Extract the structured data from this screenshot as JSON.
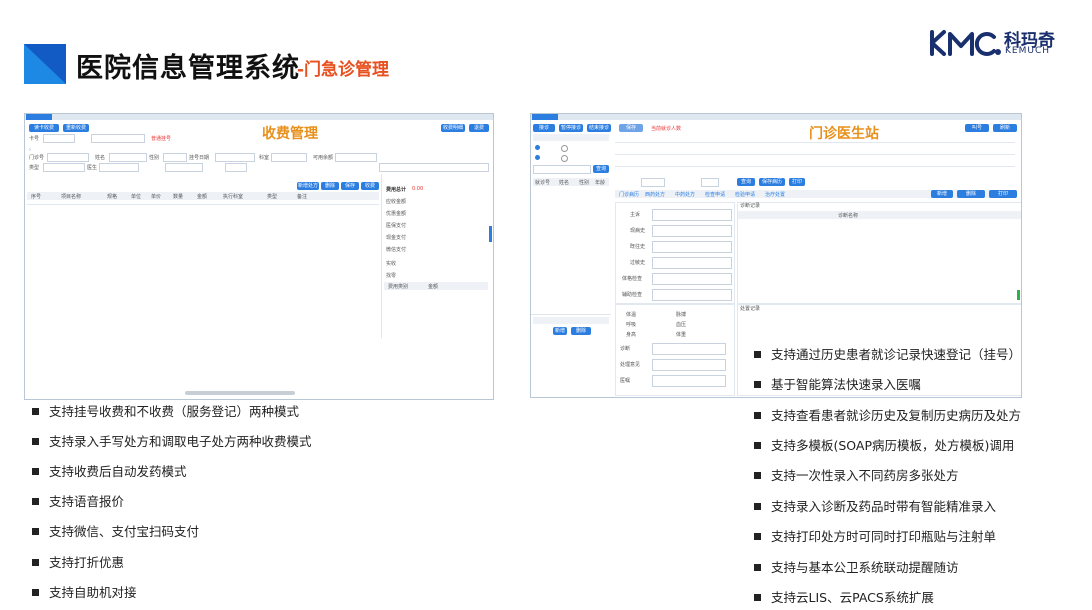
{
  "header": {
    "title": "医院信息管理系统",
    "subtitle": "-门急诊管理"
  },
  "logo": {
    "name_cn": "科玛奇",
    "name_en": "KEMUCH",
    "mark": "KMC-logo-mark",
    "brand_color": "#1a2f6e"
  },
  "colors": {
    "accent_blue": "#2b7de0",
    "title_orange": "#e8901c",
    "subtitle_red": "#e8501f",
    "triangle_blue": "#1565d8"
  },
  "left_screenshot": {
    "label": "收费管理",
    "buttons": {
      "top1": "读卡收费",
      "top2": "重新收费",
      "right1": "收费明细",
      "right2": "退费",
      "row1": "新增处方",
      "row2": "删除",
      "row3": "保存",
      "row4": "收费"
    },
    "fields": {
      "search_label": "卡号",
      "patient_no": "门诊号",
      "name": "姓名",
      "gender": "性别",
      "date": "挂号日期",
      "dept": "科室",
      "doctor": "医生",
      "notice": "可用余额",
      "red_note": "普通挂号",
      "type": "类型"
    },
    "table_headers": [
      "序号",
      "项目名称",
      "规格",
      "单位",
      "单价",
      "数量",
      "金额",
      "执行科室",
      "类型",
      "备注"
    ],
    "summary": {
      "total_label": "费用总计",
      "total_value": "0.00",
      "pay_label": "实收",
      "change_label": "找零",
      "rows": [
        "应收金额",
        "优惠金额",
        "医保支付",
        "现金支付",
        "微信支付"
      ]
    },
    "footer_headers": [
      "费用类别",
      "金额"
    ]
  },
  "right_screenshot": {
    "label": "门诊医生站",
    "buttons": {
      "b1": "接诊",
      "b2": "暂停接诊",
      "b3": "结束接诊",
      "b4": "保存",
      "r1": "叫号",
      "r2": "刷新",
      "t1": "查询",
      "t2": "保存病历",
      "t3": "打印",
      "g1": "新增",
      "g2": "删除"
    },
    "red_note": "当前就诊人数",
    "tabs": [
      "门诊病历",
      "西药处方",
      "中药处方",
      "检查申请",
      "检验申请",
      "治疗处置"
    ],
    "form_labels": [
      "主诉",
      "现病史",
      "既往史",
      "过敏史",
      "体格检查",
      "辅助检查"
    ],
    "vital_labels": [
      "体温",
      "脉搏",
      "呼吸",
      "血压",
      "身高",
      "体重"
    ],
    "left_list_headers": [
      "就诊号",
      "姓名",
      "性别",
      "年龄"
    ],
    "diagnosis_header": "诊断名称",
    "section_titles": [
      "诊断记录",
      "处置记录",
      "健康宣教"
    ],
    "footer_labels": [
      "诊断",
      "处理意见",
      "医嘱"
    ]
  },
  "left_bullets": [
    "支持挂号收费和不收费（服务登记）两种模式",
    "支持录入手写处方和调取电子处方两种收费模式",
    "支持收费后自动发药模式",
    "支持语音报价",
    "支持微信、支付宝扫码支付",
    "支持打折优惠",
    "支持自助机对接"
  ],
  "right_bullets": [
    "支持通过历史患者就诊记录快速登记（挂号）",
    "基于智能算法快速录入医嘱",
    "支持查看患者就诊历史及复制历史病历及处方",
    "支持多模板(SOAP病历模板，处方模板)调用",
    "支持一次性录入不同药房多张处方",
    "支持录入诊断及药品时带有智能精准录入",
    "支持打印处方时可同时打印瓶贴与注射单",
    "支持与基本公卫系统联动提醒随访",
    "支持云LIS、云PACS系统扩展"
  ]
}
